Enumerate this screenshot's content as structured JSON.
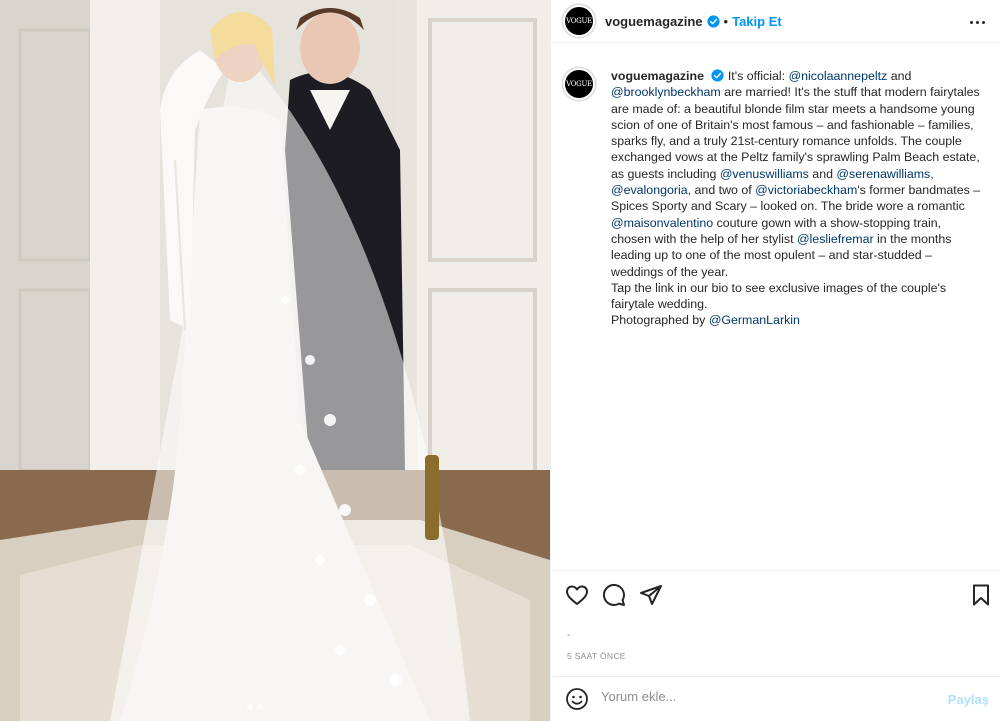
{
  "post": {
    "account": {
      "avatar_text": "VOGUE",
      "username": "voguemagazine",
      "verified": true,
      "separator": "•",
      "follow_label": "Takip Et"
    },
    "caption": {
      "username": "voguemagazine",
      "segments": [
        {
          "text": " It's official: ",
          "mention": false
        },
        {
          "text": "@nicolaannepeltz",
          "mention": true
        },
        {
          "text": " and ",
          "mention": false
        },
        {
          "text": "@brooklynbeckham",
          "mention": true
        },
        {
          "text": " are married! It's the stuff that modern fairytales are made of: a beautiful blonde film star meets a handsome young scion of one of Britain's most famous – and fashionable – families, sparks fly, and a truly 21st-century romance unfolds. The couple exchanged vows at the Peltz family's sprawling Palm Beach estate, as guests including ",
          "mention": false
        },
        {
          "text": "@venuswilliams",
          "mention": true
        },
        {
          "text": " and ",
          "mention": false
        },
        {
          "text": "@serenawilliams",
          "mention": true
        },
        {
          "text": ", ",
          "mention": false
        },
        {
          "text": "@evalongoria",
          "mention": true
        },
        {
          "text": ", and two of ",
          "mention": false
        },
        {
          "text": "@victoriabeckham",
          "mention": true
        },
        {
          "text": "'s former bandmates – Spices Sporty and Scary – looked on. The bride wore a romantic ",
          "mention": false
        },
        {
          "text": "@maisonvalentino",
          "mention": true
        },
        {
          "text": " couture gown with a show-stopping train, chosen with the help of her stylist ",
          "mention": false
        },
        {
          "text": "@lesliefremar",
          "mention": true
        },
        {
          "text": " in the months leading up to one of the most opulent – and star-studded – weddings of the year.",
          "mention": false
        },
        {
          "text": "\nTap the link in our bio to see exclusive images of the couple's fairytale wedding.\nPhotographed by ",
          "mention": false
        },
        {
          "text": "@GermanLarkin",
          "mention": true
        }
      ]
    },
    "actions": {
      "like_icon": "heart-icon",
      "comment_icon": "comment-icon",
      "share_icon": "send-icon",
      "save_icon": "bookmark-icon"
    },
    "likes_placeholder": "-",
    "timestamp": "5 SAAT ÖNCE",
    "comment": {
      "emoji_icon": "smiley-icon",
      "placeholder": "Yorum ekle...",
      "post_label": "Paylaş"
    },
    "carousel": {
      "total": 2,
      "active": 0
    }
  },
  "colors": {
    "link_blue": "#0095f6",
    "mention_blue": "#00376b",
    "muted": "#8e8e8e",
    "border": "#efefef"
  }
}
